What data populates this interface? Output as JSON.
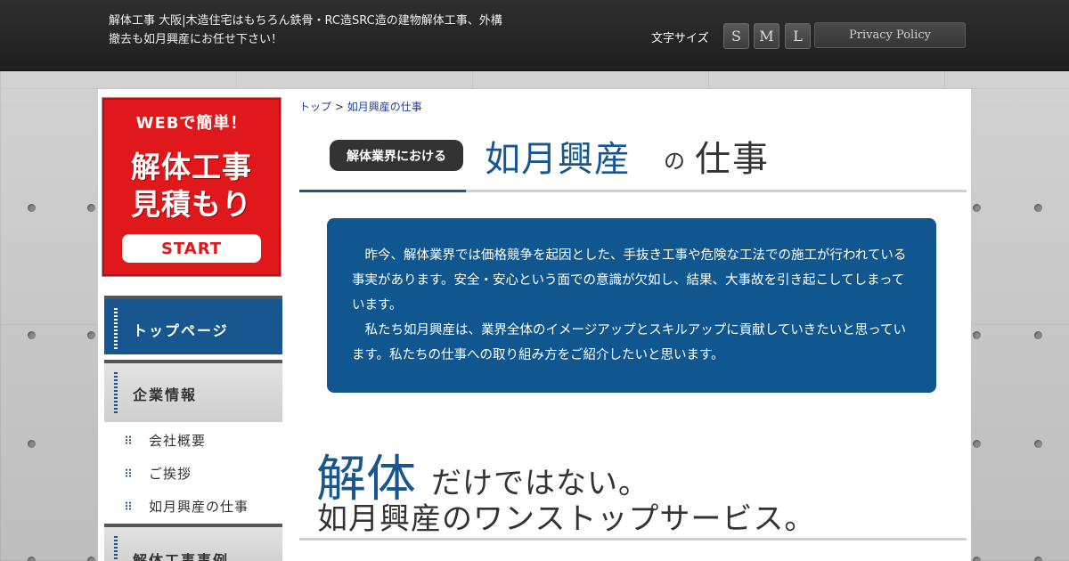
{
  "header": {
    "tagline": "解体工事 大阪|木造住宅はもちろん鉄骨・RC造SRC造の建物解体工事、外構撤去も如月興産にお任せ下さい！",
    "font_size_label": "文字サイズ",
    "font_sizes": [
      "S",
      "M",
      "L"
    ],
    "privacy_policy": "Privacy Policy"
  },
  "sidebar": {
    "estimate_banner": {
      "top": "WEBで簡単！",
      "line1": "解体工事",
      "line2": "見積もり",
      "button": "START"
    },
    "nav": {
      "top_page": "トップページ",
      "company_info": "企業情報",
      "company_items": [
        "会社概要",
        "ご挨拶",
        "如月興産の仕事"
      ],
      "demolition_cases": "解体工事事例"
    }
  },
  "breadcrumb": {
    "home": "トップ",
    "separator": " > ",
    "current": "如月興産の仕事"
  },
  "page_title": {
    "pill": "解体業界における",
    "company": "如月興産",
    "particle": "の",
    "work": "仕事"
  },
  "intro": {
    "para1": "昨今、解体業界では価格競争を起因とした、手抜き工事や危険な工法での施工が行われている事実があります。安全・安心という面での意識が欠如し、結果、大事故を引き起こしてしまっています。",
    "para2": "私たち如月興産は、業界全体のイメージアップとスキルアップに貢献していきたいと思っています。私たちの仕事への取り組み方をご紹介したいと思います。"
  },
  "section_heading": {
    "kaitai": "解体",
    "dake": "だけではない。",
    "line2": "如月興産のワンストップサービス。"
  },
  "colors": {
    "brand_blue": "#17568e",
    "estimate_red": "#e0171b",
    "header_dark": "#262626"
  }
}
